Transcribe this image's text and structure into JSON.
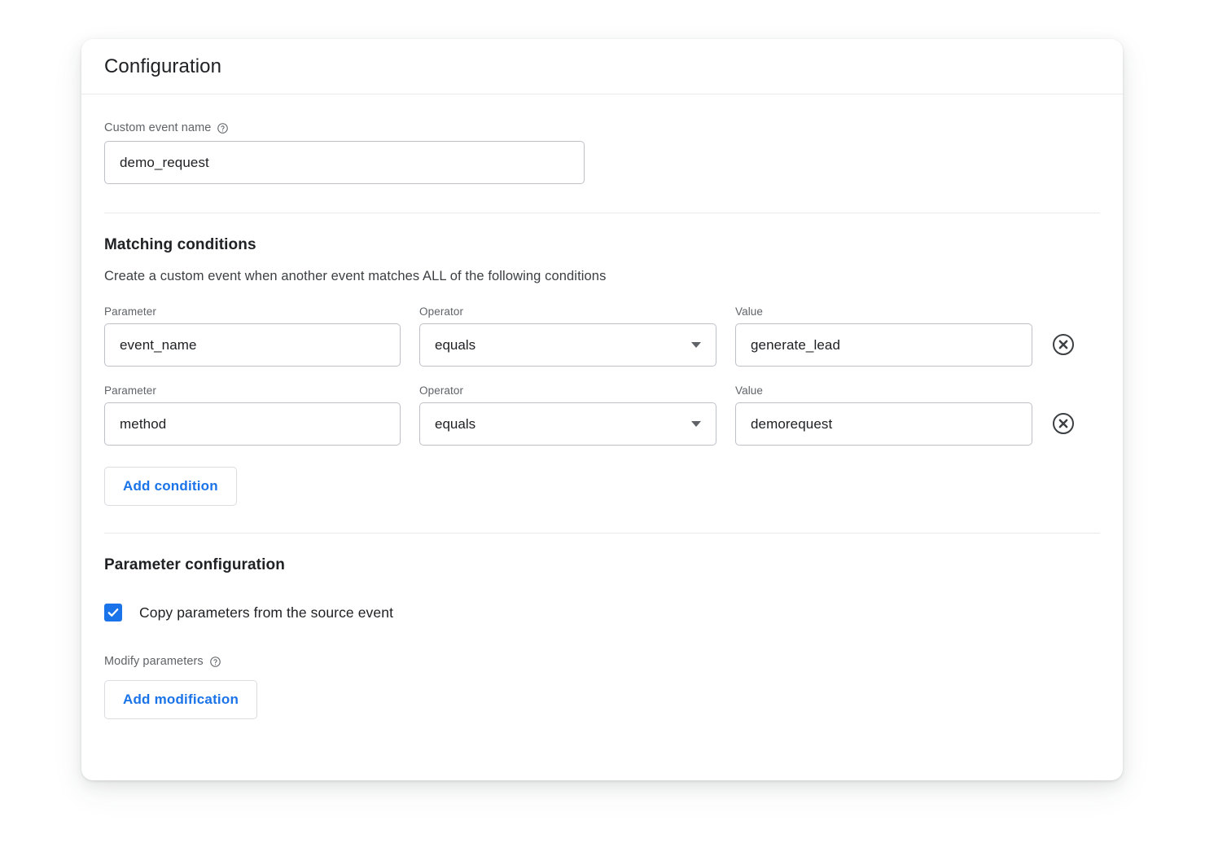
{
  "card": {
    "title": "Configuration"
  },
  "event_name_field": {
    "label": "Custom event name",
    "help_icon": "help-circle-icon",
    "value": "demo_request",
    "placeholder": ""
  },
  "matching": {
    "title": "Matching conditions",
    "description": "Create a custom event when another event matches ALL of the following conditions",
    "column_labels": {
      "parameter": "Parameter",
      "operator": "Operator",
      "value": "Value"
    },
    "rows": [
      {
        "parameter": "event_name",
        "operator": "equals",
        "value": "generate_lead",
        "remove_icon": "remove-circle-icon"
      },
      {
        "parameter": "method",
        "operator": "equals",
        "value": "demorequest",
        "remove_icon": "remove-circle-icon"
      }
    ],
    "add_condition_label": "Add condition"
  },
  "parameter_config": {
    "title": "Parameter configuration",
    "copy_params": {
      "label": "Copy parameters from the source event",
      "checked": true
    },
    "modify_params": {
      "label": "Modify parameters",
      "help_icon": "help-circle-icon"
    },
    "add_modification_label": "Add modification"
  },
  "colors": {
    "accent": "#1a73e8",
    "text_primary": "#202124",
    "text_secondary": "#5f6368",
    "border": "#bdc1c6",
    "divider": "#e8eaed",
    "card_bg": "#ffffff",
    "page_bg": "#ffffff"
  }
}
